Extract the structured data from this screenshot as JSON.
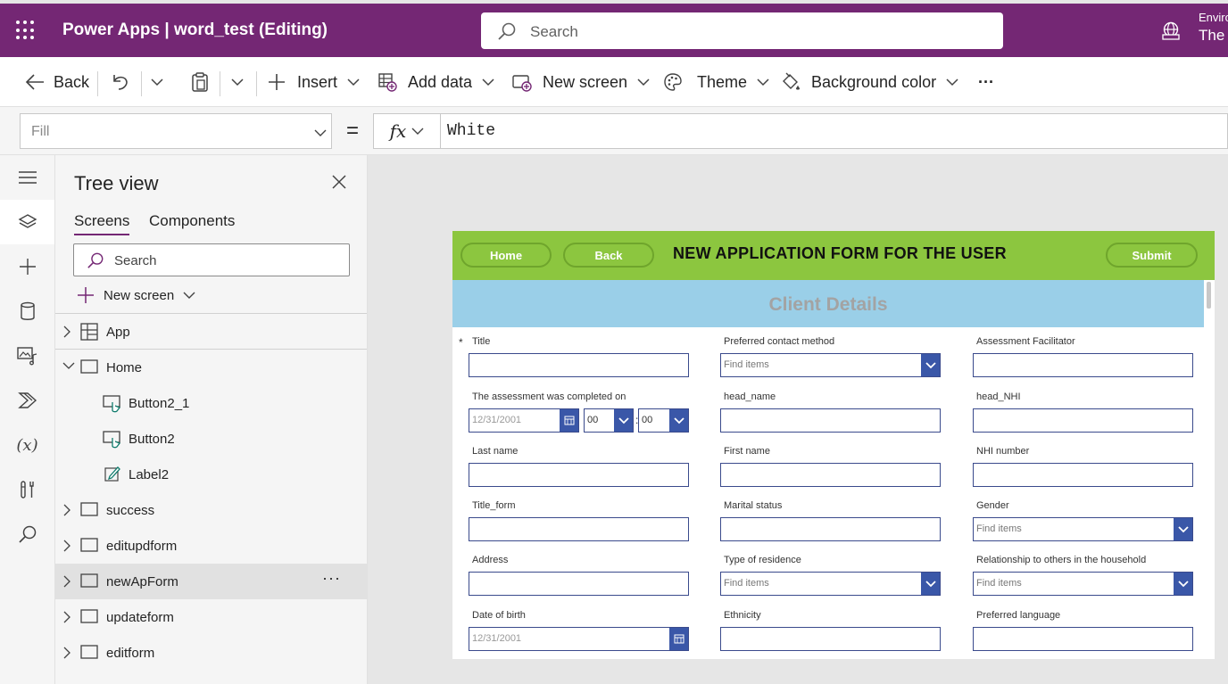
{
  "topbar": {
    "app_title": "Power Apps  |  word_test (Editing)",
    "search_placeholder": "Search",
    "env_label": "Enviro",
    "env_value": "The"
  },
  "toolbar": {
    "back": "Back",
    "insert": "Insert",
    "add_data": "Add data",
    "new_screen": "New screen",
    "theme": "Theme",
    "background_color": "Background color",
    "more": "···"
  },
  "formula": {
    "property": "Fill",
    "equals": "=",
    "fx": "fx",
    "value": "White"
  },
  "rail": {
    "variables": "(x)"
  },
  "tree": {
    "title": "Tree view",
    "tabs": [
      "Screens",
      "Components"
    ],
    "search_placeholder": "Search",
    "new_screen": "New screen",
    "nodes": [
      {
        "label": "App"
      },
      {
        "label": "Home"
      },
      {
        "label": "Button2_1"
      },
      {
        "label": "Button2"
      },
      {
        "label": "Label2"
      },
      {
        "label": "success"
      },
      {
        "label": "editupdform"
      },
      {
        "label": "newApForm",
        "more": "···"
      },
      {
        "label": "updateform"
      },
      {
        "label": "editform"
      }
    ]
  },
  "form": {
    "home_btn": "Home",
    "back_btn": "Back",
    "title": "NEW APPLICATION FORM FOR THE USER",
    "submit_btn": "Submit",
    "section": "Client Details",
    "required_mark": "*",
    "find_items": "Find items",
    "date_placeholder": "12/31/2001",
    "hour": "00",
    "minute": "00",
    "colon": ":",
    "labels": {
      "title": "Title",
      "preferred_contact": "Preferred contact method",
      "assessment_facilitator": "Assessment Facilitator",
      "assessment_completed": "The assessment was completed on",
      "head_name": "head_name",
      "head_nhi": "head_NHI",
      "last_name": "Last name",
      "first_name": "First name",
      "nhi_number": "NHI number",
      "title_form": "Title_form",
      "marital_status": "Marital status",
      "gender": "Gender",
      "address": "Address",
      "type_of_residence": "Type of residence",
      "relationship": "Relationship to others in the household",
      "date_of_birth": "Date of birth",
      "ethnicity": "Ethnicity",
      "preferred_language": "Preferred language"
    }
  },
  "colors": {
    "brand": "#742774",
    "header_green": "#8cc63f",
    "section_blue": "#9acfe8",
    "control_blue": "#3a57a8"
  }
}
